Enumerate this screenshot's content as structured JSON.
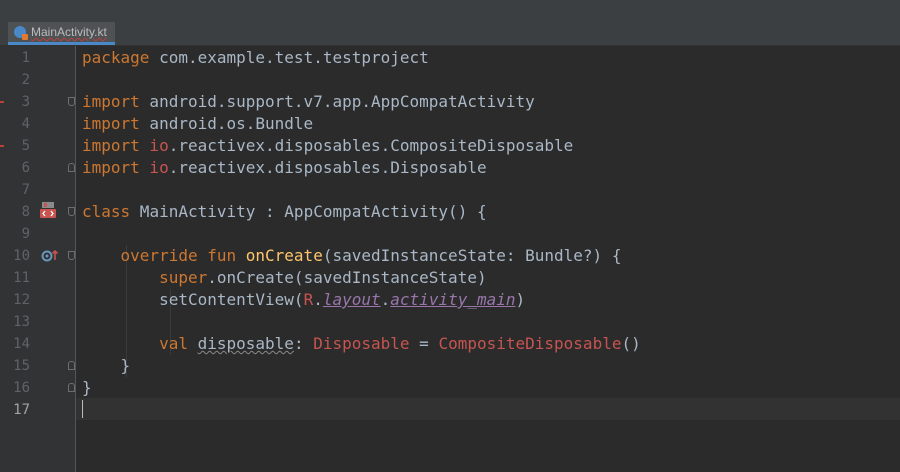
{
  "tab": {
    "file_name": "MainActivity.kt"
  },
  "line_numbers": [
    "1",
    "2",
    "3",
    "4",
    "5",
    "6",
    "7",
    "8",
    "9",
    "10",
    "11",
    "12",
    "13",
    "14",
    "15",
    "16",
    "17"
  ],
  "code": {
    "l1_kw": "package",
    "l1_rest": " com.example.test.testproject",
    "l3_kw": "import",
    "l3_rest": " android.support.v7.app.AppCompatActivity",
    "l4_kw": "import",
    "l4_rest": " android.os.Bundle",
    "l5_kw": "import",
    "l5_pkg": " io",
    "l5_rest": ".reactivex.disposables.CompositeDisposable",
    "l6_kw": "import",
    "l6_pkg": " io",
    "l6_rest": ".reactivex.disposables.Disposable",
    "l8_kw": "class",
    "l8_rest": " MainActivity : AppCompatActivity() {",
    "l10_indent": "    ",
    "l10_kw": "override fun",
    "l10_fn": " onCreate",
    "l10_rest": "(savedInstanceState: Bundle?) {",
    "l11_indent": "        ",
    "l11_kw": "super",
    "l11_rest": ".onCreate(savedInstanceState)",
    "l12_indent": "        ",
    "l12_a": "setContentView(",
    "l12_r": "R",
    "l12_dot1": ".",
    "l12_layout": "layout",
    "l12_dot2": ".",
    "l12_main": "activity_main",
    "l12_close": ")",
    "l14_indent": "        ",
    "l14_kw": "val",
    "l14_sp": " ",
    "l14_var": "disposable",
    "l14_colon": ": ",
    "l14_type": "Disposable",
    "l14_eq": " = ",
    "l14_ctor": "CompositeDisposable",
    "l14_paren": "()",
    "l15": "    }",
    "l16": "}"
  },
  "colors": {
    "background": "#2b2b2b",
    "keyword": "#cc7832",
    "function": "#ffc66d",
    "error": "#c75450",
    "property": "#9876aa",
    "text": "#a9b7c6"
  },
  "icons": {
    "file": "kotlin-file-icon",
    "run": "run-class-icon",
    "override": "override-method-icon"
  }
}
